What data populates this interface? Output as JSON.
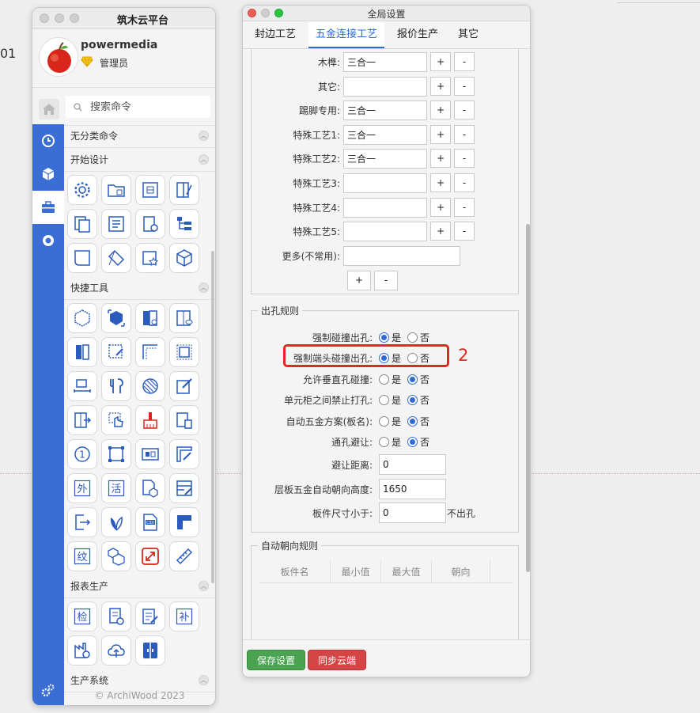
{
  "background": {
    "number": "01"
  },
  "left_window": {
    "title": "筑木云平台",
    "user": {
      "name": "powermedia",
      "role": "管理员"
    },
    "search": {
      "placeholder": "搜索命令"
    },
    "sections": {
      "uncategorized": "无分类命令",
      "start_design": "开始设计",
      "quick_tools": "快捷工具",
      "reports": "报表生产",
      "production": "生产系统"
    },
    "text_icons": {
      "wai": "外",
      "huo": "活",
      "wen": "纹",
      "jian": "检",
      "bu": "补",
      "csv": "CSV",
      "one": "1"
    },
    "footer": "© ArchiWood 2023"
  },
  "right_window": {
    "title": "全局设置",
    "tabs": [
      "封边工艺",
      "五金连接工艺",
      "报价生产",
      "其它"
    ],
    "active_tab": "五金连接工艺",
    "process_rows": [
      {
        "label": "木榫:",
        "value": "三合一"
      },
      {
        "label": "其它:",
        "value": ""
      },
      {
        "label": "踢脚专用:",
        "value": "三合一"
      },
      {
        "label": "特殊工艺1:",
        "value": "三合一"
      },
      {
        "label": "特殊工艺2:",
        "value": "三合一"
      },
      {
        "label": "特殊工艺3:",
        "value": ""
      },
      {
        "label": "特殊工艺4:",
        "value": ""
      },
      {
        "label": "特殊工艺5:",
        "value": ""
      }
    ],
    "more_label": "更多(不常用):",
    "plus": "+",
    "minus": "-",
    "drill_rules": {
      "title": "出孔规则",
      "yes": "是",
      "no": "否",
      "radios": [
        {
          "label": "强制碰撞出孔:",
          "selected": "yes"
        },
        {
          "label": "强制端头碰撞出孔:",
          "selected": "yes"
        },
        {
          "label": "允许垂直孔碰撞:",
          "selected": "no"
        },
        {
          "label": "单元柜之间禁止打孔:",
          "selected": "no"
        },
        {
          "label": "自动五金方案(板名):",
          "selected": "no"
        },
        {
          "label": "通孔避让:",
          "selected": "no"
        }
      ],
      "avoid_distance": {
        "label": "避让距离:",
        "value": "0"
      },
      "shelf_height": {
        "label": "层板五金自动朝向高度:",
        "value": "1650"
      },
      "panel_size": {
        "label": "板件尺寸小于:",
        "value": "0",
        "suffix": "不出孔"
      }
    },
    "annotation": "2",
    "auto_orient": {
      "title": "自动朝向规则",
      "columns": [
        "板件名",
        "最小值",
        "最大值",
        "朝向"
      ]
    },
    "buttons": {
      "save": "保存设置",
      "sync": "同步云端"
    }
  },
  "colors": {
    "accent": "#2f6ad9",
    "sidebar": "#3b6ed4",
    "save": "#4aa350",
    "sync": "#d64545",
    "annotation": "#e5281e"
  }
}
